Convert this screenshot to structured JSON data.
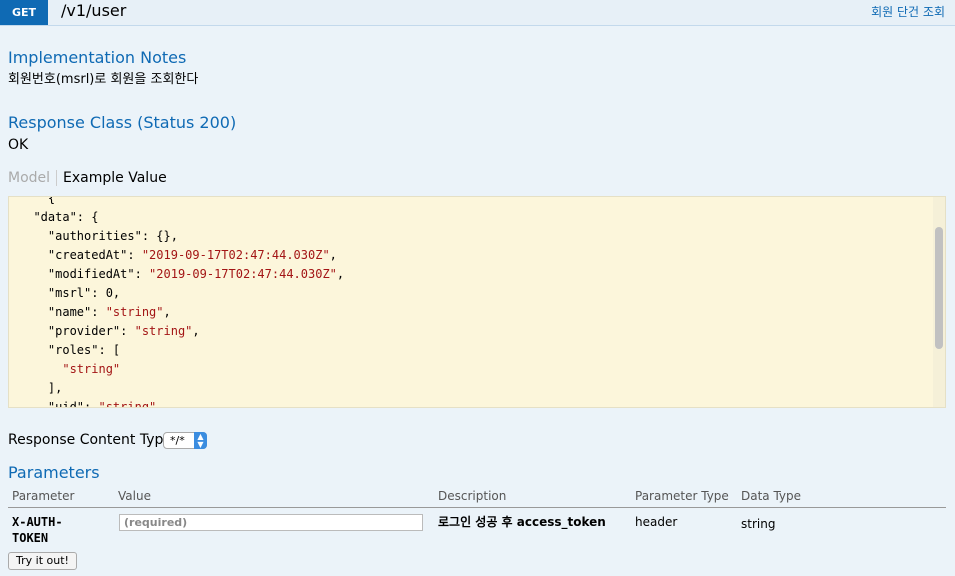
{
  "heading": {
    "method": "GET",
    "path": "/v1/user",
    "summary": "회원 단건 조회"
  },
  "notes": {
    "title": "Implementation Notes",
    "text": "회원번호(msrl)로 회원을 조회한다"
  },
  "response_class": {
    "title": "Response Class (Status 200)",
    "text": "OK"
  },
  "model_tabs": {
    "model": "Model",
    "example": "Example Value"
  },
  "example_value": {
    "lines": [
      {
        "key": "  \"data\": {",
        "val": ""
      },
      {
        "key": "    \"authorities\": {},",
        "val": ""
      },
      {
        "key": "    \"createdAt\": ",
        "val": "\"2019-09-17T02:47:44.030Z\"",
        "tail": ","
      },
      {
        "key": "    \"modifiedAt\": ",
        "val": "\"2019-09-17T02:47:44.030Z\"",
        "tail": ","
      },
      {
        "key": "    \"msrl\": 0,",
        "val": ""
      },
      {
        "key": "    \"name\": ",
        "val": "\"string\"",
        "tail": ","
      },
      {
        "key": "    \"provider\": ",
        "val": "\"string\"",
        "tail": ","
      },
      {
        "key": "    \"roles\": [",
        "val": ""
      },
      {
        "key": "      ",
        "val": "\"string\""
      },
      {
        "key": "    ],",
        "val": ""
      },
      {
        "key": "    \"uid\": ",
        "val": "\"string\""
      }
    ]
  },
  "response_content_type": {
    "label": "Response Content Type",
    "selected": "*/*"
  },
  "parameters": {
    "title": "Parameters",
    "headers": [
      "Parameter",
      "Value",
      "Description",
      "Parameter Type",
      "Data Type"
    ],
    "rows": [
      {
        "name": "X-AUTH-\nTOKEN",
        "placeholder": "(required)",
        "description": "로그인 성공 후 access_token",
        "param_type": "header",
        "data_type": "string"
      }
    ]
  },
  "try_button": "Try it out!",
  "colors": {
    "accent": "#0f6ab4",
    "background": "#ebf3f9",
    "code_bg": "#fcf6db",
    "string": "#a31515"
  }
}
